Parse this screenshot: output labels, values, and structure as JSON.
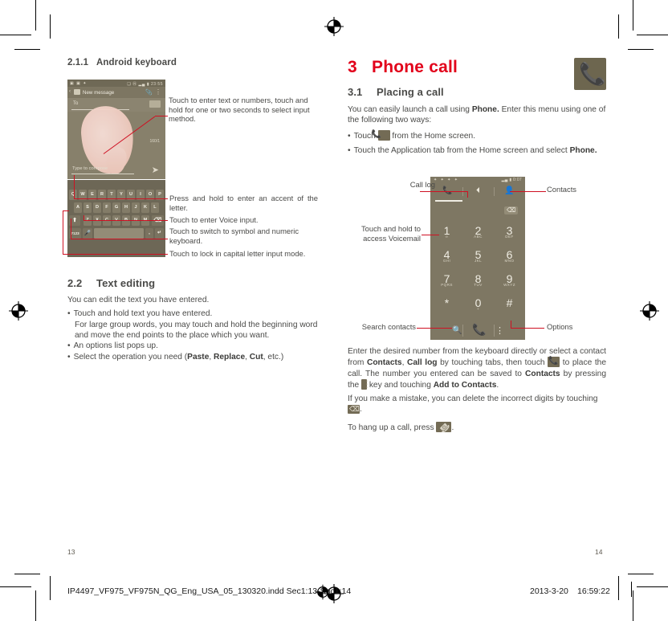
{
  "left_column": {
    "section_number": "2.1.1",
    "section_title": "Android keyboard",
    "messaging_screenshot": {
      "status_left_icons": "▣ ▣ ✦",
      "status_right": "❑ Ⓝ  ▂▄ ▮ 23:55",
      "back_glyph": "‹",
      "title": "New message",
      "attach_glyph": "ὌE",
      "overflow_glyph": "⋮",
      "to_label": "To",
      "char_count": "160/1",
      "compose_placeholder": "Type to compose",
      "send_glyph": "➤"
    },
    "keyboard": {
      "row1": [
        "Q",
        "W",
        "E",
        "R",
        "T",
        "Y",
        "U",
        "I",
        "O",
        "P"
      ],
      "row2": [
        "A",
        "S",
        "D",
        "F",
        "G",
        "H",
        "J",
        "K",
        "L"
      ],
      "row3": [
        "Z",
        "X",
        "C",
        "V",
        "B",
        "N",
        "M"
      ],
      "shift_glyph": "⬆",
      "backspace_glyph": "⌫",
      "symbol_key": "?123",
      "mic_glyph": "Ἲ4",
      "comma": ",",
      "enter_glyph": "↵"
    },
    "callouts": [
      "Touch to enter text or numbers, touch and hold for one or two seconds to select input method.",
      "Press and hold to enter an accent of the letter.",
      "Touch to enter Voice input.",
      "Touch to switch to symbol and numeric keyboard.",
      "Touch to lock in capital letter input mode."
    ],
    "text_editing": {
      "section_number": "2.2",
      "section_title": "Text editing",
      "intro": "You can edit the text you have entered.",
      "bullet1": "Touch and hold text you have entered.",
      "bullet1_cont": "For large group words, you may touch and hold the beginning word and move the end points to the place which you want.",
      "bullet2": "An options list pops up.",
      "bullet3_pre": "Select the operation you need (",
      "bullet3_bold1": "Paste",
      "bullet3_sep1": ", ",
      "bullet3_bold2": "Replace",
      "bullet3_sep2": ", ",
      "bullet3_bold3": "Cut",
      "bullet3_post": ", etc.)"
    }
  },
  "right_column": {
    "chapter_number": "3",
    "chapter_title": "Phone call",
    "chapter_icon": "phone-handset-icon",
    "section_number": "3.1",
    "section_title": "Placing a call",
    "intro_pre": "You can easily launch a call using ",
    "intro_bold": "Phone.",
    "intro_post": " Enter this menu using one of the following two ways:",
    "bullet1_pre": "Touch ",
    "bullet1_post": " from the Home screen.",
    "bullet2_pre": "Touch the Application tab from the Home screen and select ",
    "bullet2_bold": "Phone.",
    "dialer_screenshot": {
      "status_left": "✦ ✦ ✦ ✦",
      "status_right": "▂▄ ▮ 0:07",
      "tab_call_glyph": "ὍE",
      "tab_log_glyph": "◴",
      "tab_contacts_glyph": "὆4",
      "delete_glyph": "⌫",
      "keys": [
        {
          "n": "1",
          "s": "∞"
        },
        {
          "n": "2",
          "s": "ABC"
        },
        {
          "n": "3",
          "s": "DEF"
        },
        {
          "n": "4",
          "s": "GHI"
        },
        {
          "n": "5",
          "s": "JKL"
        },
        {
          "n": "6",
          "s": "MNO"
        },
        {
          "n": "7",
          "s": "PQRS"
        },
        {
          "n": "8",
          "s": "TUV"
        },
        {
          "n": "9",
          "s": "WXYZ"
        },
        {
          "n": "*",
          "s": ""
        },
        {
          "n": "0",
          "s": "+"
        },
        {
          "n": "#",
          "s": ""
        }
      ],
      "search_glyph": "ὐD",
      "call_glyph": "ὍE",
      "options_glyph": "⋮"
    },
    "callouts": {
      "call_log": "Call log",
      "contacts": "Contacts",
      "voicemail": "Touch and hold to access Voicemail",
      "search_contacts": "Search contacts",
      "options": "Options"
    },
    "body": {
      "p1_a": "Enter the desired number from the keyboard directly or select a contact from ",
      "p1_b1": "Contacts",
      "p1_c": ", ",
      "p1_b2": "Call log",
      "p1_d": " by touching tabs, then touch ",
      "p1_e": " to place the call. The number you entered can be saved to ",
      "p1_b3": "Contacts",
      "p1_f": " by pressing the ",
      "p1_g": " key and touching ",
      "p1_b4": "Add to Contacts",
      "p1_h": ".",
      "p2_a": "If you make a mistake, you can delete the incorrect digits by touching ",
      "p2_b": ".",
      "p3_a": "To hang up a call, press ",
      "p3_b": "."
    }
  },
  "footer": {
    "page_left": "13",
    "page_right": "14",
    "filename": "IP4497_VF975_VF975N_QG_Eng_USA_05_130320.indd   Sec1:13-Sec1:14",
    "date": "2013-3-20",
    "time": "16:59:22"
  },
  "colors": {
    "chapter_red": "#e2001a",
    "callout_red": "#cf1123",
    "body_text": "#4a4a48",
    "screenshot_bg": "#7e7763"
  }
}
